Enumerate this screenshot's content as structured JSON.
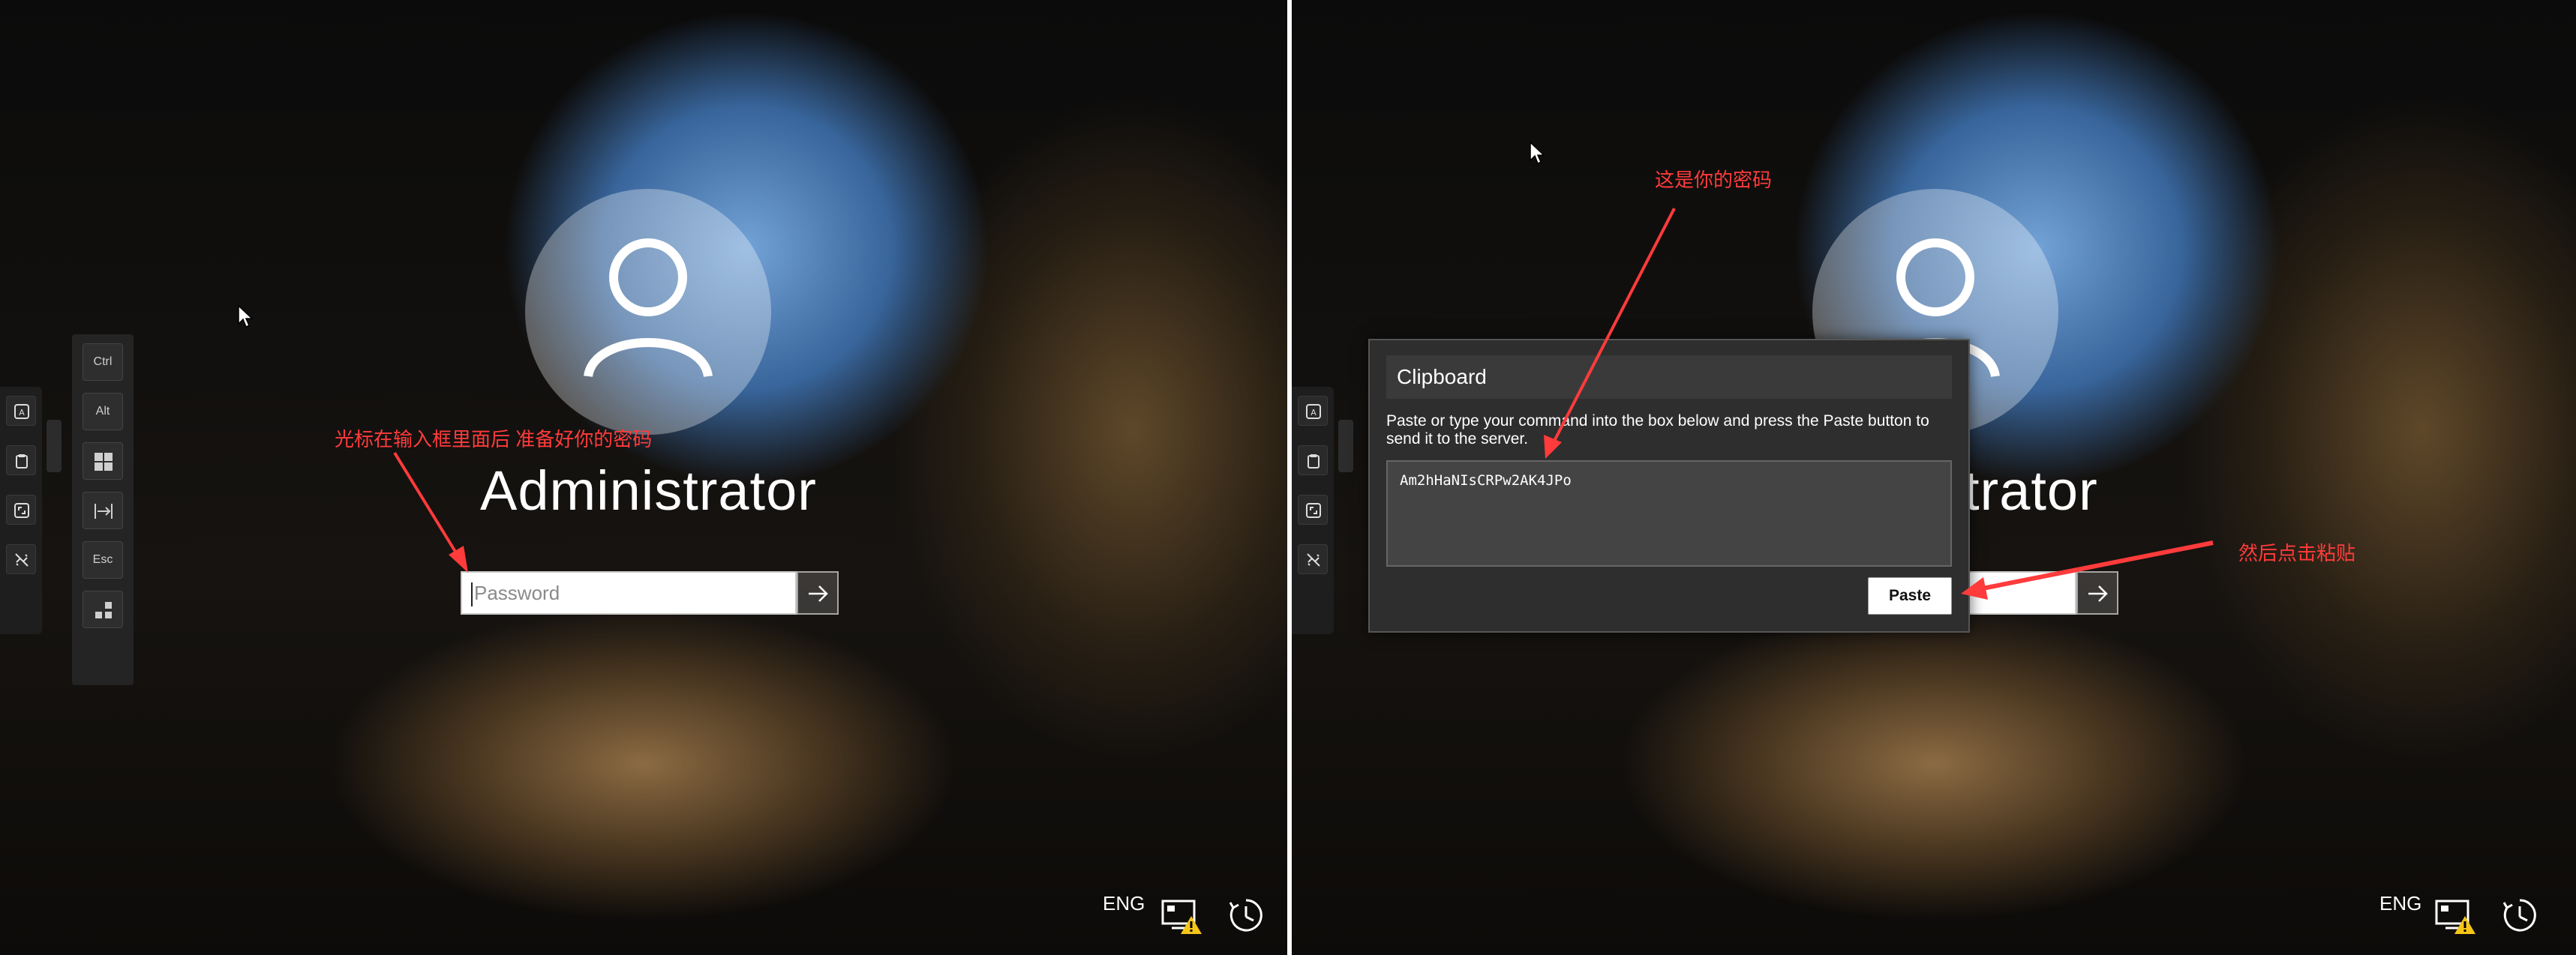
{
  "left": {
    "annotation": "光标在输入框里面后 准备好你的密码",
    "login": {
      "username": "Administrator",
      "password_placeholder": "Password"
    },
    "keys": {
      "ctrl": "Ctrl",
      "alt": "Alt",
      "esc": "Esc"
    }
  },
  "right": {
    "annotation_top": "这是你的密码",
    "annotation_right": "然后点击粘贴",
    "login": {
      "username_visible": "trator"
    },
    "clipboard": {
      "title": "Clipboard",
      "description": "Paste or type your command into the box below and press the Paste button to send it to the server.",
      "content": "Am2hHaNIsCRPw2AK4JPo",
      "paste_label": "Paste"
    }
  },
  "status": {
    "language": "ENG"
  },
  "colors": {
    "annotation": "#ff3b3b",
    "dialog_bg": "#2e2e2e"
  }
}
